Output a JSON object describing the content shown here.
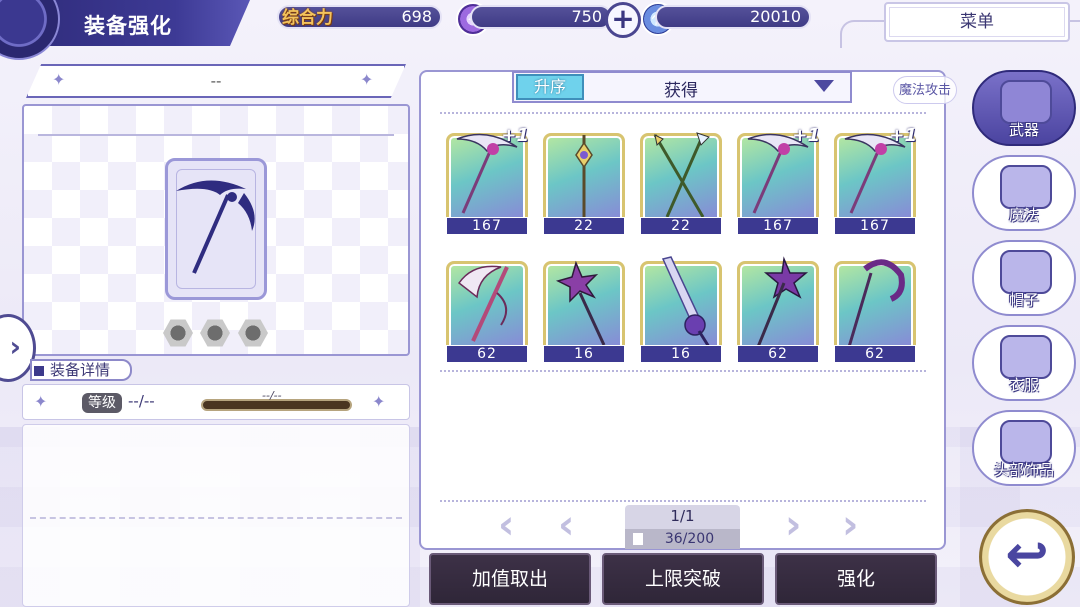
{
  "header": {
    "title": "装备强化",
    "power_label": "综合力",
    "power_value": "698",
    "star_value": "750",
    "mana_value": "20010",
    "menu_label": "菜单"
  },
  "equipment": {
    "name": "--",
    "detail_tab": "装备详情",
    "level_label": "等级",
    "level_value": "--/--",
    "exp_text": "--/--"
  },
  "sort": {
    "order_label": "升序",
    "field_label": "获得",
    "filter_label": "魔法攻击"
  },
  "items": [
    {
      "value": "167",
      "plus": "+1",
      "icon": "scythe-icon"
    },
    {
      "value": "22",
      "plus": "",
      "icon": "staff-icon"
    },
    {
      "value": "22",
      "plus": "",
      "icon": "twin-spear-icon"
    },
    {
      "value": "167",
      "plus": "+1",
      "icon": "scythe-icon"
    },
    {
      "value": "167",
      "plus": "+1",
      "icon": "scythe-icon"
    },
    {
      "value": "62",
      "plus": "",
      "icon": "crescent-blade-icon"
    },
    {
      "value": "16",
      "plus": "",
      "icon": "star-mace-icon"
    },
    {
      "value": "16",
      "plus": "",
      "icon": "great-sword-icon"
    },
    {
      "value": "62",
      "plus": "",
      "icon": "star-staff-icon"
    },
    {
      "value": "62",
      "plus": "",
      "icon": "crook-staff-icon"
    }
  ],
  "pager": {
    "page": "1/1",
    "count": "36/200"
  },
  "actions": {
    "withdraw": "加值取出",
    "limit_break": "上限突破",
    "enhance": "强化"
  },
  "categories": [
    {
      "label": "武器",
      "active": true
    },
    {
      "label": "魔法",
      "active": false
    },
    {
      "label": "帽子",
      "active": false
    },
    {
      "label": "衣服",
      "active": false
    },
    {
      "label": "头部饰品",
      "active": false
    }
  ],
  "colors": {
    "primary": "#3c3991",
    "accent_cyan": "#6fd2ec",
    "power_gold": "#f4c35c",
    "action_dark": "#2f2638"
  }
}
